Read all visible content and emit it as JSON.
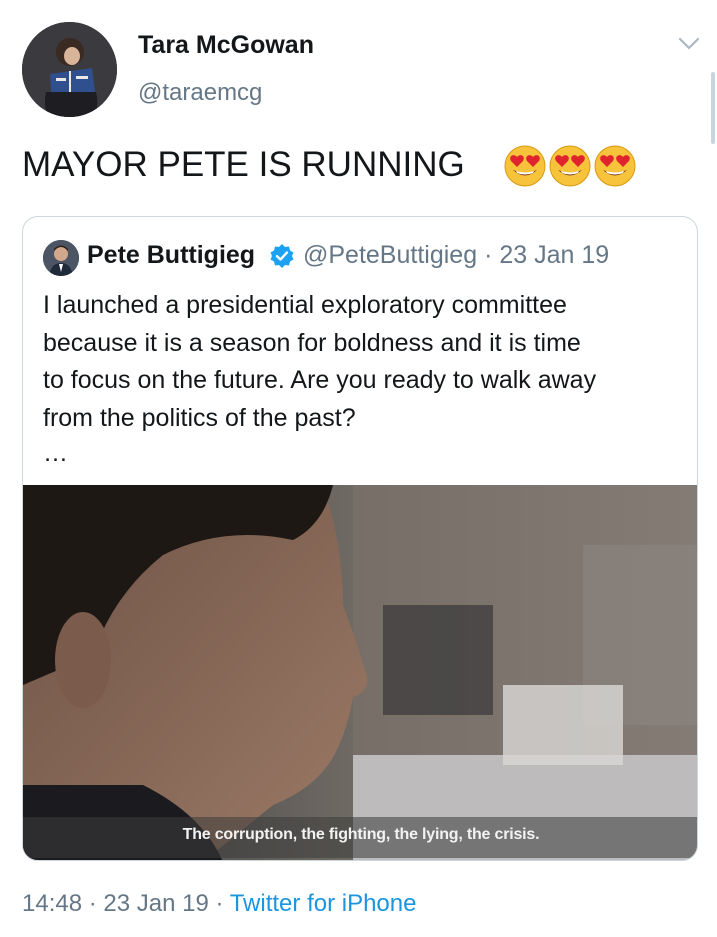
{
  "author": {
    "name": "Tara McGowan",
    "handle": "@taraemcg",
    "avatar_icon": "avatar-reading-book"
  },
  "tweet": {
    "text": "MAYOR PETE IS RUNNING",
    "emojis": [
      "heart-eyes-emoji",
      "heart-eyes-emoji",
      "heart-eyes-emoji"
    ]
  },
  "quoted": {
    "name": "Pete Buttigieg",
    "verified_icon": "verified-badge-icon",
    "handle": "@PeteButtigieg",
    "separator": "·",
    "date": "23 Jan 19",
    "text_lines": [
      "I launched a presidential exploratory committee",
      "because it is a season for boldness and it is time",
      "to focus on the future. Are you ready to walk away",
      "from the politics of the past?"
    ],
    "ellipsis": "…",
    "media": {
      "type": "video-still",
      "subtitle": "The corruption, the fighting, the lying, the crisis."
    }
  },
  "meta": {
    "time": "14:48",
    "sep1": " · ",
    "date": "23 Jan 19",
    "sep2": " · ",
    "source": "Twitter for iPhone"
  },
  "colors": {
    "text": "#14171a",
    "secondary": "#657786",
    "link": "#1b95e0",
    "verified": "#1da1f2",
    "border": "#ccd6dd"
  },
  "icons": {
    "caret": "chevron-down-icon"
  }
}
